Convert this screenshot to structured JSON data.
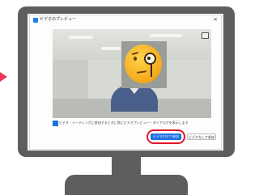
{
  "dialog": {
    "title": "ビデオのプレビュー",
    "close_label": "×",
    "consent_text": "ビデオ・ミーティングに参加するときに常にビデオプレビュー・ダイアログを表示します",
    "join_with_video_label": "ビデオ付きで参加",
    "join_without_video_label": "ビデオなしで参加"
  },
  "colors": {
    "accent": "#1e6fe0",
    "highlight": "#e4142a",
    "bezel": "#5e5e60"
  },
  "icons": {
    "expand": "expand-icon",
    "app": "app-icon",
    "checkbox": "checkbox-checked-icon"
  }
}
